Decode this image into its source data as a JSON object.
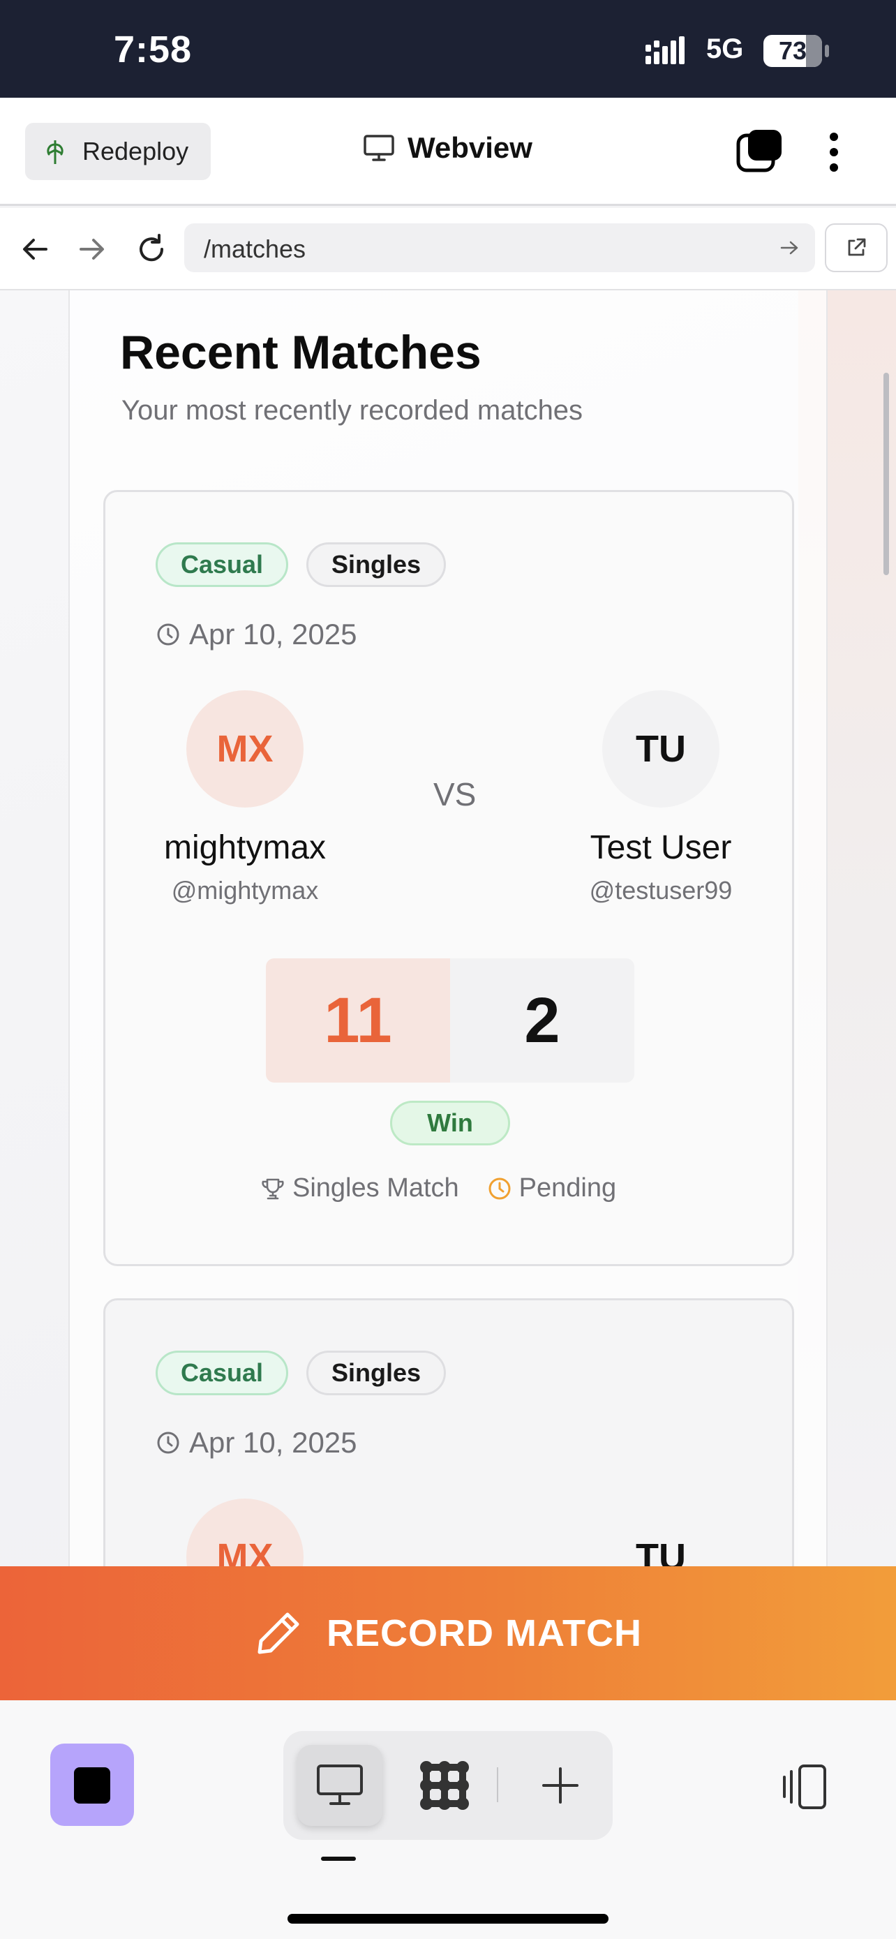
{
  "status_bar": {
    "time": "7:58",
    "network": "5G",
    "battery": "73",
    "battery_level": 0.73
  },
  "app_bar": {
    "redeploy_label": "Redeploy",
    "title": "Webview"
  },
  "url_bar": {
    "url": "/matches"
  },
  "page": {
    "title": "Recent Matches",
    "subtitle": "Your most recently recorded matches",
    "matches": [
      {
        "type_badge": "Casual",
        "format_badge": "Singles",
        "date": "Apr 10, 2025",
        "player_a": {
          "initials": "MX",
          "name": "mightymax",
          "handle": "@mightymax",
          "score": "11"
        },
        "vs": "VS",
        "player_b": {
          "initials": "TU",
          "name": "Test User",
          "handle": "@testuser99",
          "score": "2"
        },
        "result": "Win",
        "match_kind": "Singles Match",
        "status": "Pending"
      },
      {
        "type_badge": "Casual",
        "format_badge": "Singles",
        "date": "Apr 10, 2025",
        "player_a": {
          "initials": "MX"
        },
        "player_b": {
          "initials": "TU"
        }
      }
    ]
  },
  "record_button": {
    "label": "RECORD MATCH"
  },
  "colors": {
    "accent": "#e9643a",
    "accent_end": "#f29d3a",
    "win_green": "#2f7a3e",
    "pending_amber": "#f0a030",
    "stop_purple": "#b6a4fb"
  },
  "icons": [
    "tree-icon",
    "monitor-icon",
    "tabs-icon",
    "more-icon",
    "back-icon",
    "forward-icon",
    "reload-icon",
    "go-arrow-icon",
    "external-link-icon",
    "clock-icon",
    "trophy-icon",
    "pencil-icon",
    "stop-icon",
    "desktop-icon",
    "apps-icon",
    "plus-icon",
    "rotate-icon"
  ]
}
